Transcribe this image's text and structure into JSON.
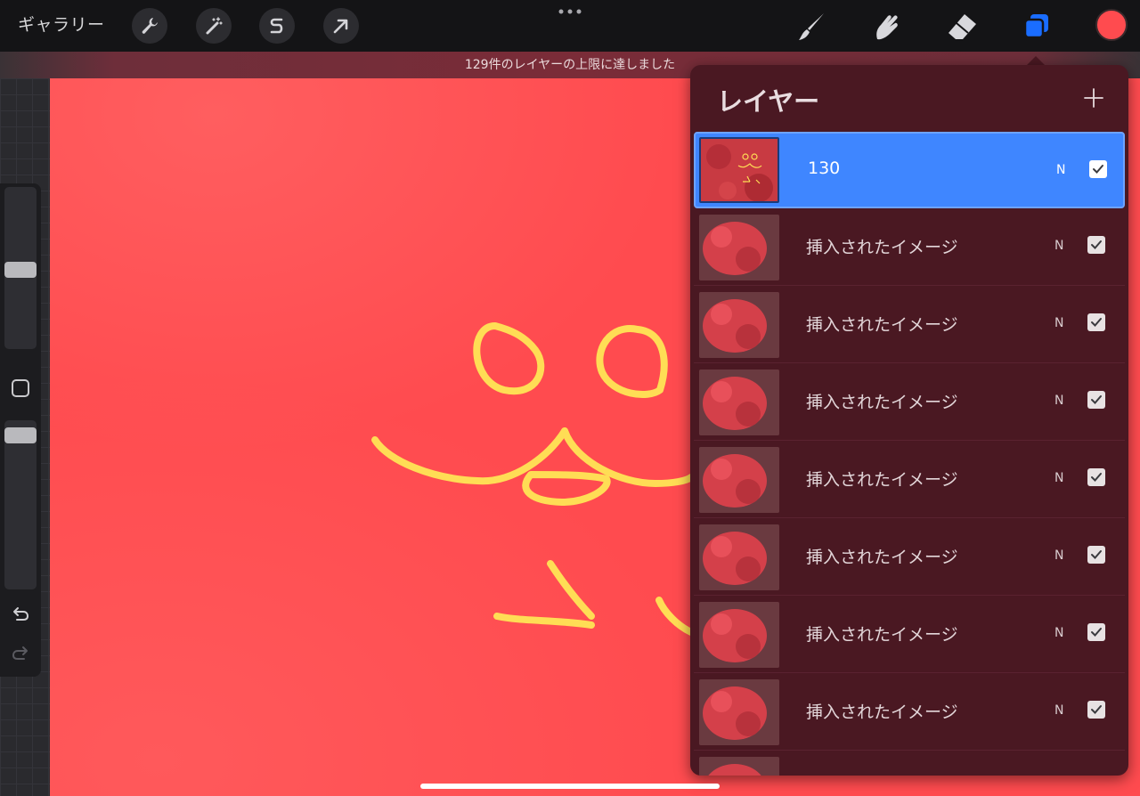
{
  "toolbar": {
    "gallery_label": "ギャラリー",
    "left_tools": [
      {
        "name": "actions",
        "icon": "wrench-icon"
      },
      {
        "name": "adjustments",
        "icon": "magic-wand-icon"
      },
      {
        "name": "selection",
        "icon": "selection-s-icon"
      },
      {
        "name": "transform",
        "icon": "arrow-cursor-icon"
      }
    ],
    "right_tools": [
      {
        "name": "brush",
        "icon": "brush-icon"
      },
      {
        "name": "smudge",
        "icon": "smudge-hand-icon"
      },
      {
        "name": "eraser",
        "icon": "eraser-icon"
      },
      {
        "name": "layers",
        "icon": "layers-icon"
      }
    ],
    "current_color": "#ff4b4f"
  },
  "notice": {
    "text": "129件のレイヤーの上限に達しました"
  },
  "canvas": {
    "background_color": "#ff4b4f",
    "stroke_color": "#ffdd55"
  },
  "layers_panel": {
    "title": "レイヤー",
    "layers": [
      {
        "name": "130",
        "blend": "N",
        "visible": true,
        "selected": true
      },
      {
        "name": "挿入されたイメージ",
        "blend": "N",
        "visible": true,
        "selected": false
      },
      {
        "name": "挿入されたイメージ",
        "blend": "N",
        "visible": true,
        "selected": false
      },
      {
        "name": "挿入されたイメージ",
        "blend": "N",
        "visible": true,
        "selected": false
      },
      {
        "name": "挿入されたイメージ",
        "blend": "N",
        "visible": true,
        "selected": false
      },
      {
        "name": "挿入されたイメージ",
        "blend": "N",
        "visible": true,
        "selected": false
      },
      {
        "name": "挿入されたイメージ",
        "blend": "N",
        "visible": true,
        "selected": false
      },
      {
        "name": "挿入されたイメージ",
        "blend": "N",
        "visible": true,
        "selected": false
      }
    ]
  }
}
